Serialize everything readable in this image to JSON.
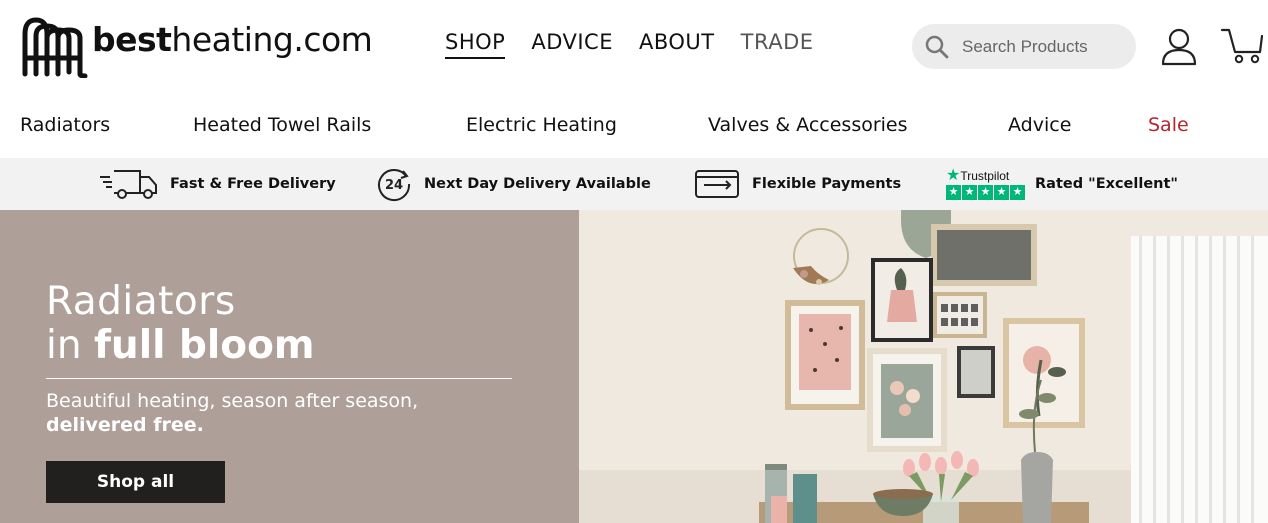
{
  "header": {
    "logo": {
      "bold": "best",
      "regular": "heating.com"
    },
    "nav": [
      {
        "label": "SHOP",
        "active": true
      },
      {
        "label": "ADVICE",
        "active": false
      },
      {
        "label": "ABOUT",
        "active": false
      },
      {
        "label": "TRADE",
        "active": false
      }
    ],
    "search": {
      "placeholder": "Search Products",
      "value": "",
      "icon": "search-icon"
    },
    "account_icon": "user-icon",
    "cart_icon": "cart-icon"
  },
  "categories": [
    {
      "label": "Radiators"
    },
    {
      "label": "Heated Towel Rails"
    },
    {
      "label": "Electric Heating"
    },
    {
      "label": "Valves & Accessories"
    },
    {
      "label": "Advice"
    },
    {
      "label": "Sale",
      "color": "#b3262e"
    }
  ],
  "usps": [
    {
      "icon": "delivery-truck-icon",
      "label": "Fast & Free Delivery"
    },
    {
      "icon": "24-hour-icon",
      "icon_text": "24",
      "label": "Next Day Delivery Available"
    },
    {
      "icon": "payment-card-icon",
      "label": "Flexible Payments"
    },
    {
      "icon": "trustpilot-stars-icon",
      "brand": "Trustpilot",
      "label": "Rated \"Excellent\""
    }
  ],
  "hero": {
    "line1": "Radiators",
    "line2_thin": "in",
    "line2_bold": "full bloom",
    "sub1": "Beautiful heating, season after season,",
    "sub2": "delivered free.",
    "cta": "Shop all",
    "background": "#ae9f98",
    "image": "living-room-photo"
  },
  "colors": {
    "accent_sale": "#b3262e",
    "button_bg": "#221f1f",
    "usp_bar": "#f2f2f2",
    "trustpilot_green": "#00b67a"
  }
}
